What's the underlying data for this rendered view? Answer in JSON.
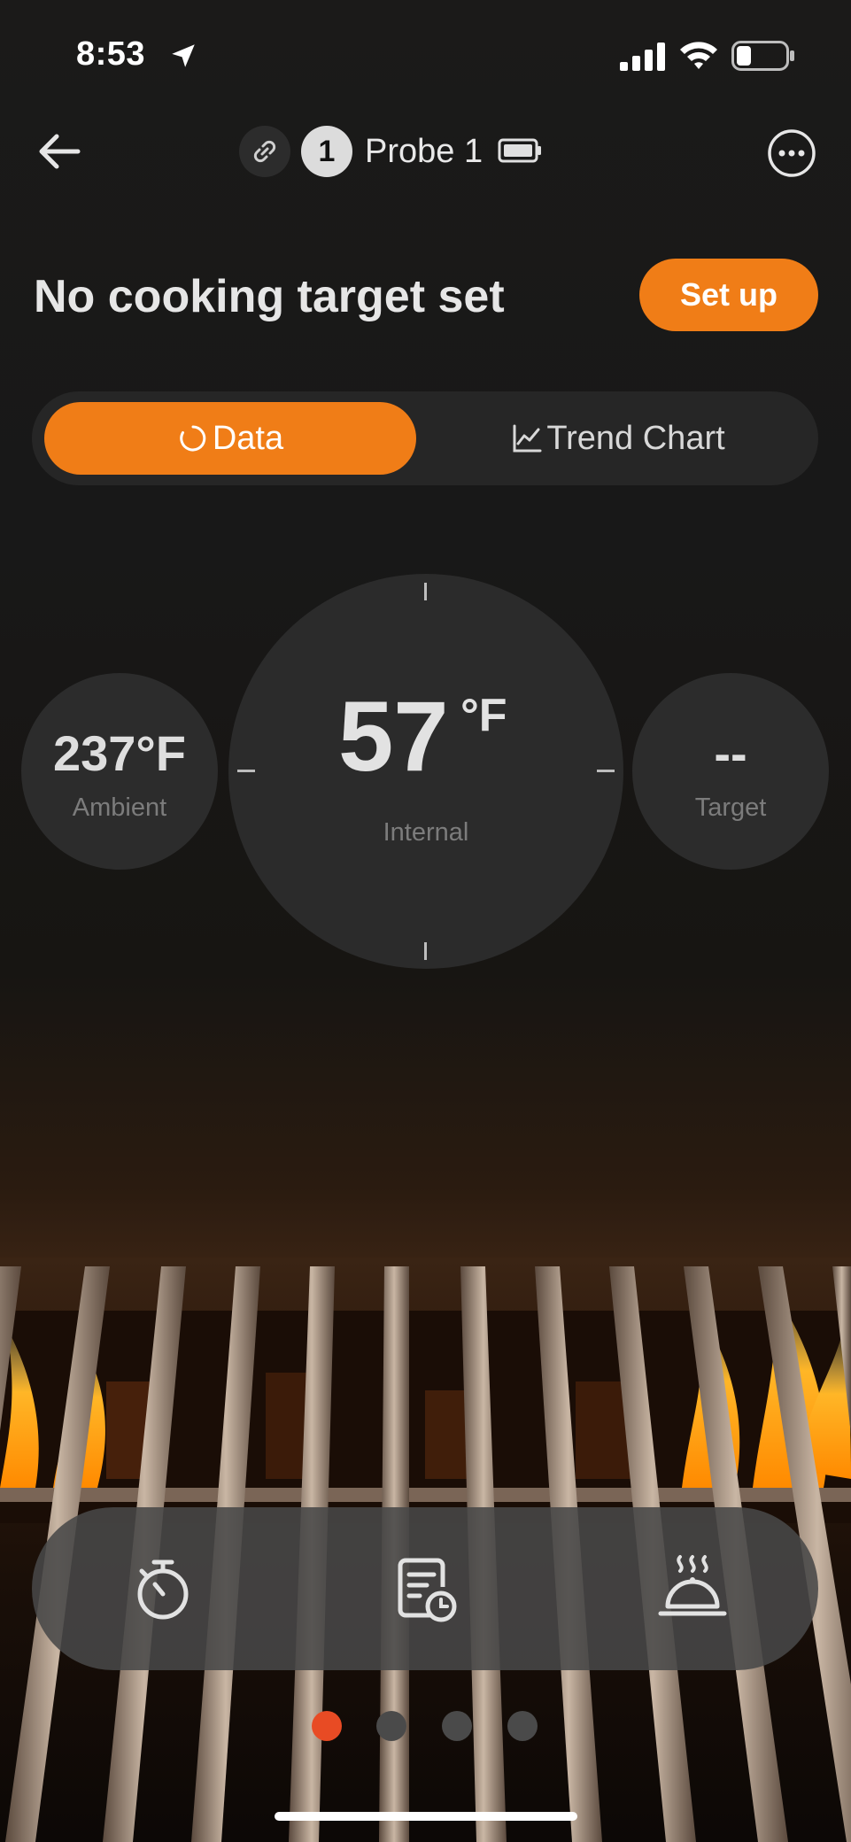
{
  "status_bar": {
    "time": "8:53"
  },
  "header": {
    "probe_number": "1",
    "probe_name": "Probe 1"
  },
  "headline": {
    "text": "No cooking target set",
    "setup_label": "Set up"
  },
  "tabs": [
    {
      "label": "Data",
      "active": true,
      "icon": "data-ring-icon"
    },
    {
      "label": "Trend Chart",
      "active": false,
      "icon": "trend-chart-icon"
    }
  ],
  "readings": {
    "ambient": {
      "value": "237°F",
      "label": "Ambient"
    },
    "internal": {
      "value": "57",
      "unit": "°F",
      "label": "Internal"
    },
    "target": {
      "value": "--",
      "label": "Target"
    }
  },
  "bottom_bar": {
    "items": [
      {
        "icon": "stopwatch-icon"
      },
      {
        "icon": "cook-log-icon"
      },
      {
        "icon": "serving-cloche-icon"
      }
    ]
  },
  "pager": {
    "count": 4,
    "active_index": 0
  },
  "colors": {
    "accent": "#f07d17",
    "active_dot": "#e84b24",
    "background": "#181818"
  }
}
